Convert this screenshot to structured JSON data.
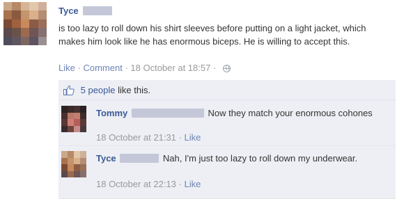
{
  "post": {
    "author": "Tyce",
    "text": "is too lazy to roll down his shirt sleeves before putting on a light jacket, which makes him look like he has enormous biceps. He is willing to accept this.",
    "actions": {
      "like": "Like",
      "comment": "Comment",
      "timestamp": "18 October at 18:57",
      "privacy_icon": "globe-icon"
    }
  },
  "likes": {
    "icon": "thumbs-up-icon",
    "count_text": "5 people",
    "suffix": " like this."
  },
  "comments": [
    {
      "author": "Tommy",
      "text": "Now they match your enormous cohones",
      "timestamp": "18 October at 21:31",
      "like": "Like"
    },
    {
      "author": "Tyce",
      "text": "Nah, I'm just too lazy to roll down my underwear.",
      "timestamp": "18 October at 22:13",
      "like": "Like"
    }
  ],
  "colors": {
    "link": "#3b5998",
    "muted_link": "#6d84b4",
    "ufi_background": "#edeff4",
    "redaction": "#c3c7d8"
  }
}
